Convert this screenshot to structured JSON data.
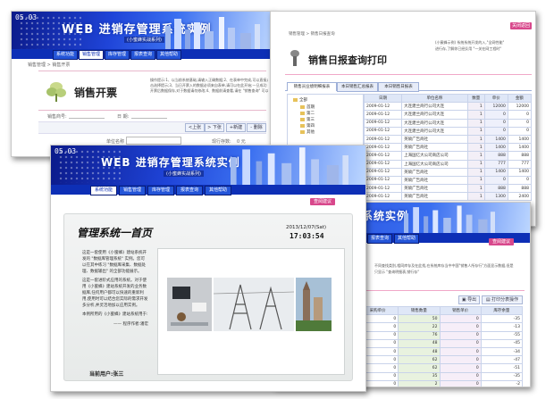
{
  "back_window": {
    "logo": "05.03",
    "title": "WEB  进销存管理系统实例",
    "subtitle": "(小蜜蜂实战系列)",
    "nav_tabs": [
      "系统功能",
      "销售管理",
      "库存管理",
      "报表查询",
      "其他帮助"
    ],
    "breadcrumb": "销售管理 > 销售开票",
    "note_line1": "操作提示:1、以当前系统基础,请输入正确数据;2、在表单中完成,可以直接点",
    "note_line2": "击选择提示;3、当日开票入的数据必须来自表单,请可以在此开始;一旦成功",
    "note_line3": "开票后数据保存,对于数据请勿修改;4、数据前请查看,请在 \"销售查询\" 可以找到",
    "field_vendor": "销售商号:",
    "field_date": "日 期:",
    "tool_buttons": [
      "<上张",
      "> 下张",
      "+新建",
      "- 删除"
    ],
    "field_unit": "单位名称",
    "field_stock": "现行存数:",
    "field_stock_val": "0 元",
    "brush_title": "销售开票"
  },
  "right_window": {
    "top_note_1": "(小蜜蜂示例) 系统系统开发的入,\"全网性能\"",
    "top_note_2": "进行存,了解你已经反用 \"一关在网工程时\"",
    "close_btn": "关闭返回",
    "breadcrumb": "销售管理 > 销售日报查询",
    "brush_title": "销售日报查询打印",
    "tabs": [
      "销售员业绩明细报表",
      "本日销售汇总报表",
      "本日销售日报表"
    ],
    "tree": [
      "全部",
      "首期",
      "第二",
      "第三",
      "第四",
      "其他"
    ],
    "columns": [
      "日期",
      "单位名称",
      "数量",
      "单价",
      "金额"
    ],
    "rows": [
      [
        "2009-01-12",
        "大连建兰商行公司大连",
        "1",
        "12000",
        "12000"
      ],
      [
        "2009-01-12",
        "大连建兰商行公司大连",
        "1",
        "0",
        "0"
      ],
      [
        "2009-01-12",
        "大连建兰商行公司大连",
        "1",
        "0",
        "0"
      ],
      [
        "2009-01-12",
        "大连建兰商行公司大连",
        "1",
        "0",
        "0"
      ],
      [
        "2009-01-12",
        "英硕广告商社",
        "1",
        "1400",
        "1400"
      ],
      [
        "2009-01-12",
        "英硕广告商社",
        "1",
        "1400",
        "1400"
      ],
      [
        "2009-01-12",
        "上海国亿大公司商店公司",
        "1",
        "888",
        "888"
      ],
      [
        "2009-01-12",
        "上海国亿大公司商店公司",
        "1",
        "777",
        "777"
      ],
      [
        "2009-01-12",
        "英硕广告商社",
        "1",
        "1400",
        "1400"
      ],
      [
        "2009-01-12",
        "英硕广告商社",
        "1",
        "0",
        "0"
      ],
      [
        "2009-01-12",
        "英硕广告商社",
        "1",
        "888",
        "888"
      ],
      [
        "2009-01-12",
        "英硕广告商社",
        "1",
        "1300",
        "2400"
      ]
    ]
  },
  "bottom_right": {
    "title_part": "系统实例",
    "nav_tabs": [
      "报表查询",
      "其他帮助"
    ],
    "pink_btn": "查阅建议",
    "note_1": "不同查找类别,相同库存及在此找,在系统库存当中中国\"销售人所存行\"方面显示数据,但是",
    "note_2": "只显示 \"查询明细表,销行存\"",
    "btn_export": "导出",
    "btn_print": "打印分表操作",
    "columns": [
      "采购单价",
      "销售数量",
      "销售单价",
      "库存余量"
    ],
    "rows": [
      [
        "0",
        "50",
        "0",
        "-35"
      ],
      [
        "0",
        "22",
        "0",
        "-13"
      ],
      [
        "0",
        "76",
        "0",
        "-55"
      ],
      [
        "0",
        "48",
        "0",
        "-45"
      ],
      [
        "0",
        "48",
        "0",
        "-34"
      ],
      [
        "0",
        "62",
        "0",
        "-47"
      ],
      [
        "0",
        "62",
        "0",
        "-51"
      ],
      [
        "0",
        "35",
        "0",
        "-35"
      ],
      [
        "0",
        "2",
        "0",
        "-2"
      ],
      [
        "0",
        "24",
        "0",
        "-21"
      ]
    ]
  },
  "front_window": {
    "logo": "05.03",
    "title": "WEB  进销存管理系统实例",
    "subtitle": "(小蜜蜂实战系列)",
    "nav_tabs": [
      "系统功能",
      "销售管理",
      "库存管理",
      "报表查询",
      "其他帮助"
    ],
    "pink_btn": "查阅建议",
    "brush_title": "管理系统一首页",
    "date": "2013/12/07(Sat)",
    "time": "17:03:54",
    "para_1": "这是一套使用《小蜜蜂》建站系统开发的 \"数据库管理系统\" 实例。您可以在其中练习 \"数据库采集、数据处理、数据输出\" 的全部功能展示。",
    "para_2": "这是一套进阶式应用的系统。对于使用《小蜜蜂》建站系统开发的业务数据库,任何用户都可以快速的重新利用,使用时可以结合您实际的需求开发多分析,并灵活地加以应用实例。",
    "para_3": "本例所用的《小蜜蜂》建站系统用于:",
    "author": "—— 程序作者:潘宏",
    "current_user_label": "当前用户:",
    "current_user": "张三"
  }
}
